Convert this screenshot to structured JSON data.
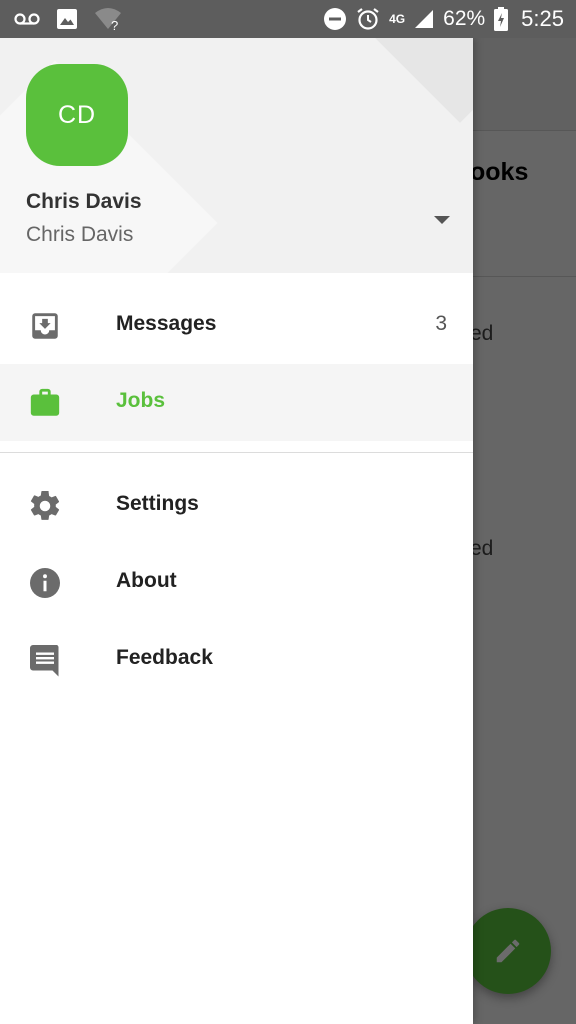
{
  "status_bar": {
    "battery_percent": "62%",
    "time": "5:25",
    "network": "4G",
    "icons": [
      "voicemail-icon",
      "image-icon",
      "wifi-unknown-icon",
      "do-not-disturb-icon",
      "alarm-icon",
      "signal-icon",
      "battery-charging-icon"
    ]
  },
  "background": {
    "toolbar_title_fragment": "ooks",
    "status_fragment_1": "ed",
    "status_fragment_2": "ed",
    "fab_icon": "edit-icon"
  },
  "account": {
    "initials": "CD",
    "name": "Chris Davis",
    "subtitle": "Chris Davis",
    "dropdown_icon": "arrow-drop-down-icon"
  },
  "nav": {
    "primary": [
      {
        "label": "Messages",
        "count": "3",
        "icon": "inbox-icon",
        "active": false
      },
      {
        "label": "Jobs",
        "count": "",
        "icon": "briefcase-icon",
        "active": true
      }
    ],
    "secondary": [
      {
        "label": "Settings",
        "icon": "gear-icon"
      },
      {
        "label": "About",
        "icon": "info-icon"
      },
      {
        "label": "Feedback",
        "icon": "feedback-icon"
      }
    ]
  },
  "colors": {
    "accent": "#5ac03c",
    "icon_gray": "#6b6b6b",
    "status_bar": "#5d5d5d"
  }
}
